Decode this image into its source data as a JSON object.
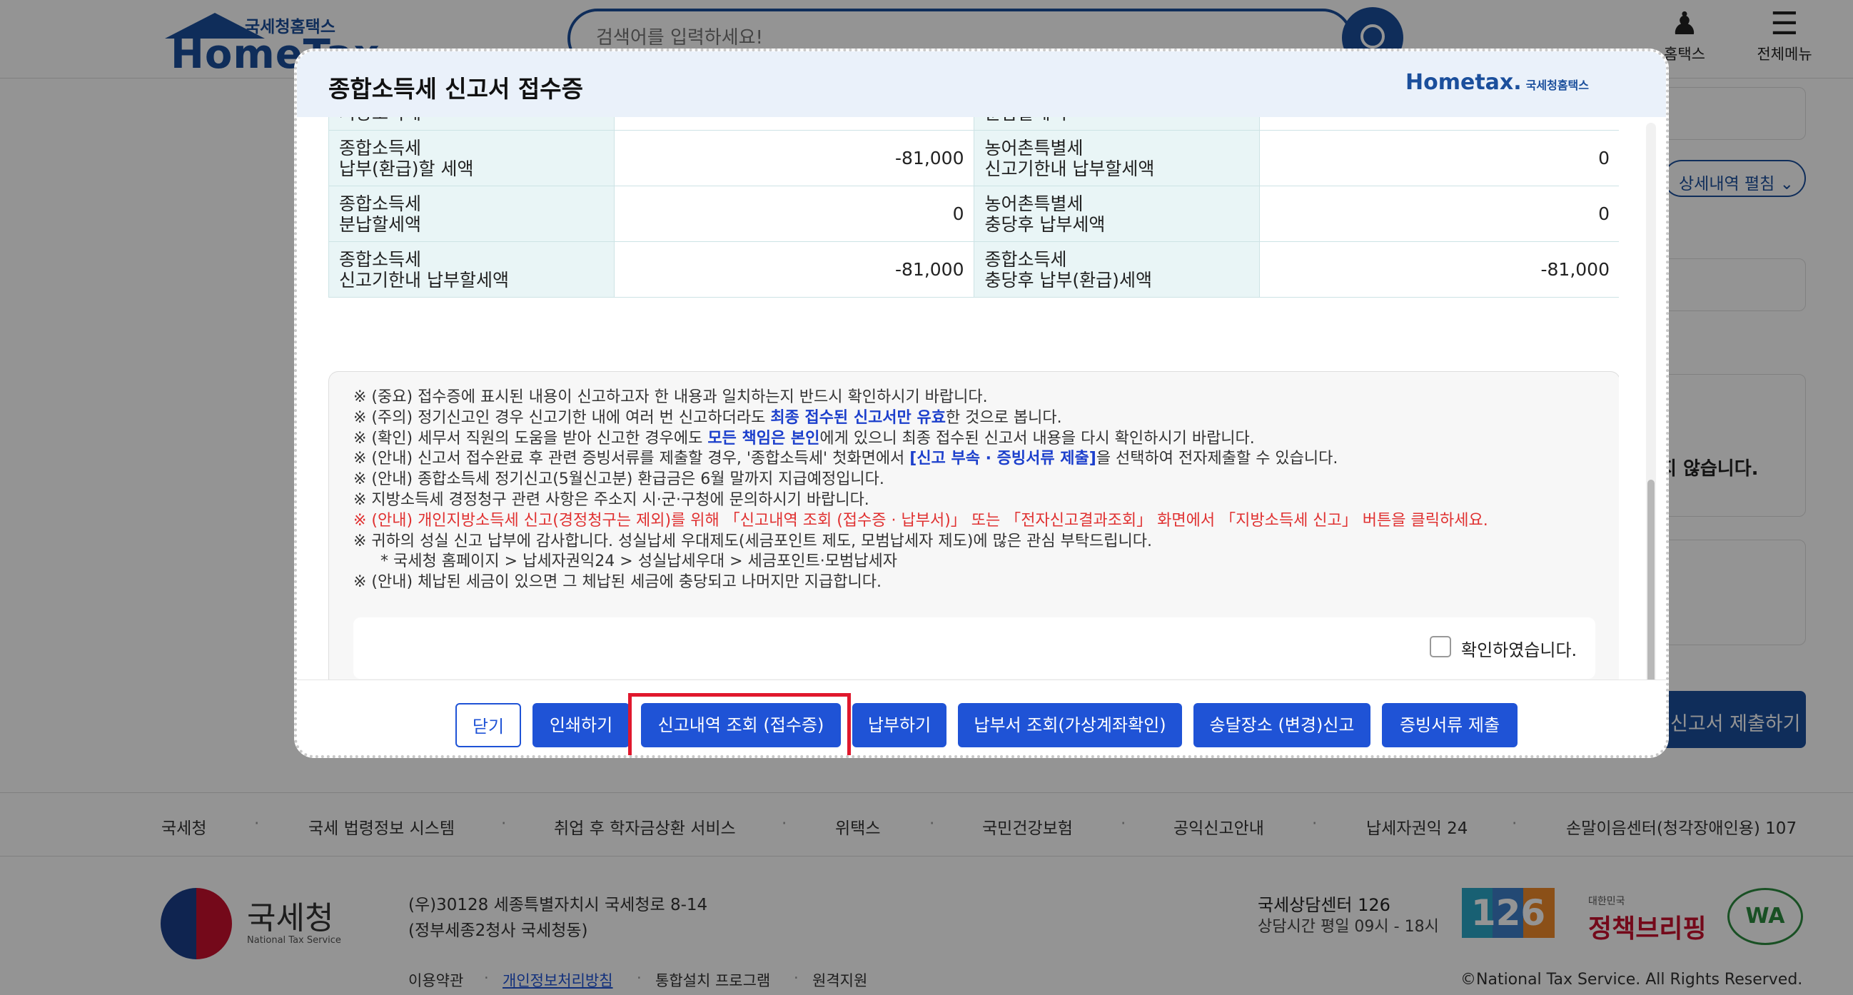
{
  "header": {
    "logo_sub": "국세청홈택스",
    "logo_main": "HomeTax",
    "search_placeholder": "검색어를 입력하세요!",
    "user_label": "홈택스",
    "menu_label": "전체메뉴"
  },
  "side": {
    "detail_toggle": "상세내역 펼침",
    "notice_text": "지 않습니다.",
    "submit_button": "신고서 제출하기"
  },
  "modal": {
    "title": "종합소득세 신고서 접수증",
    "logo_text": "Hometax.",
    "logo_sub": "국세청홈택스",
    "table_rows": [
      {
        "left_label": "지방소득세",
        "left_value": "",
        "right_label": "분납할세액",
        "right_value": ""
      },
      {
        "left_label": "종합소득세\n납부(환급)할 세액",
        "left_value": "-81,000",
        "right_label": "농어촌특별세\n신고기한내 납부할세액",
        "right_value": "0"
      },
      {
        "left_label": "종합소득세\n분납할세액",
        "left_value": "0",
        "right_label": "농어촌특별세\n충당후 납부세액",
        "right_value": "0"
      },
      {
        "left_label": "종합소득세\n신고기한내 납부할세액",
        "left_value": "-81,000",
        "right_label": "종합소득세\n충당후 납부(환급)세액",
        "right_value": "-81,000"
      }
    ],
    "notices": {
      "n1": "※ (중요) 접수증에 표시된 내용이 신고하고자 한 내용과 일치하는지 반드시 확인하시기 바랍니다.",
      "n2_pre": "※ (주의) 정기신고인 경우 신고기한 내에 여러 번 신고하더라도 ",
      "n2_hl": "최종 접수된 신고서만 유효",
      "n2_post": "한 것으로 봅니다.",
      "n3_pre": "※ (확인) 세무서 직원의 도움을 받아 신고한 경우에도 ",
      "n3_hl": "모든 책임은 본인",
      "n3_post": "에게 있으니 최종 접수된 신고서 내용을 다시 확인하시기 바랍니다.",
      "n4_pre": "※ (안내) 신고서 접수완료 후 관련 증빙서류를 제출할 경우, '종합소득세' 첫화면에서 ",
      "n4_hl": "[신고 부속 · 증빙서류 제출]",
      "n4_post": "을 선택하여 전자제출할 수 있습니다.",
      "n5": "※ (안내) 종합소득세 정기신고(5월신고분) 환급금은 6월 말까지 지급예정입니다.",
      "n6": "※ 지방소득세 경정청구 관련 사항은 주소지 시·군·구청에 문의하시기 바랍니다.",
      "n7": "※ (안내) 개인지방소득세 신고(경정청구는 제외)를 위해 「신고내역 조회 (접수증 · 납부서)」 또는 「전자신고결과조회」 화면에서 「지방소득세 신고」 버튼을 클릭하세요.",
      "n8": "※ 귀하의 성실 신고 납부에 감사합니다. 성실납세 우대제도(세금포인트 제도, 모범납세자 제도)에 많은 관심 부탁드립니다.",
      "n9": "* 국세청 홈페이지 > 납세자권익24 > 성실납세우대 > 세금포인트·모범납세자",
      "n10": "※ (안내) 체납된 세금이 있으면 그 체납된 세금에 충당되고 나머지만 지급합니다."
    },
    "confirm_label": "확인하였습니다.",
    "buttons": {
      "close": "닫기",
      "print": "인쇄하기",
      "history": "신고내역 조회 (접수증)",
      "pay": "납부하기",
      "bill": "납부서 조회(가상계좌확인)",
      "address": "송달장소 (변경)신고",
      "evidence": "증빙서류 제출"
    }
  },
  "footer": {
    "links": [
      "국세청",
      "국세 법령정보 시스템",
      "취업 후 학자금상환 서비스",
      "위택스",
      "국민건강보험",
      "공익신고안내",
      "납세자권익 24",
      "손말이음센터(청각장애인용) 107"
    ],
    "org_name": "국세청",
    "org_eng": "National Tax Service",
    "address1": "(우)30128 세종특별자치시 국세청로 8-14",
    "address2": "(정부세종2청사 국세청동)",
    "bottom_links": [
      "이용약관",
      "개인정보처리방침",
      "통합설치 프로그램",
      "원격지원"
    ],
    "center_title": "국세상담센터 126",
    "center_hours": "상담시간 평일 09시 - 18시",
    "badge_126": "126",
    "policy_small": "대한민국",
    "policy_big": "정책브리핑",
    "wa_mark": "WA",
    "copyright": "©National Tax Service. All Rights Reserved."
  }
}
